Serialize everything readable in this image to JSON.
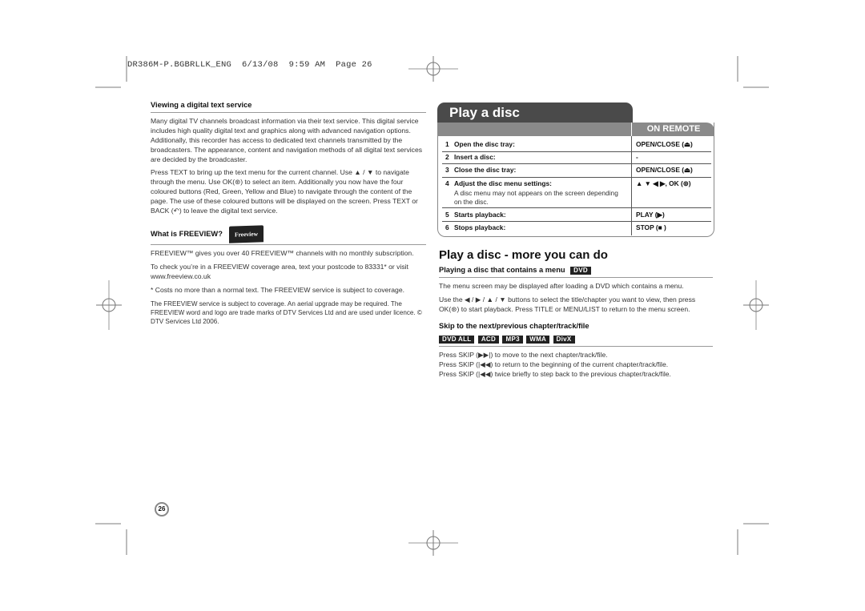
{
  "slug": {
    "file": "DR386M-P.BGBRLLK_ENG",
    "date": "6/13/08",
    "time": "9:59 AM",
    "page_label": "Page 26"
  },
  "left": {
    "section1": {
      "heading": "Viewing a digital text service",
      "p1": "Many digital TV channels broadcast information via their text service. This digital service includes high quality digital text and graphics along with advanced navigation options. Additionally, this recorder has access to dedicated text channels transmitted by the broadcasters. The appearance, content and navigation methods of all digital text services are decided by the broadcaster.",
      "p2": "Press TEXT to bring up the text menu for the current channel. Use ▲ / ▼ to navigate through the menu. Use OK(⊛) to select an item. Additionally you now have the four coloured buttons (Red, Green, Yellow and Blue) to navigate through the content of the page. The use of these coloured buttons will be displayed on the screen. Press TEXT or BACK (↶) to leave the digital text service."
    },
    "section2": {
      "heading": "What is FREEVIEW?",
      "logo_text": "Freeview",
      "p1": "FREEVIEW™ gives you over 40 FREEVIEW™ channels with no monthly subscription.",
      "p2": "To check you’re in a FREEVIEW coverage area, text your postcode to 83331* or visit www.freeview.co.uk",
      "p3": "* Costs no more than a normal text. The FREEVIEW service is subject to coverage.",
      "p4": "The FREEVIEW service is subject to coverage. An aerial upgrade may be required. The FREEVIEW word and logo are trade marks of DTV Services Ltd and are used under licence. © DTV Services Ltd 2006."
    }
  },
  "play_disc": {
    "title": "Play a disc",
    "remote_header": "ON REMOTE",
    "steps": [
      {
        "num": "1",
        "label": "Open the disc tray:",
        "key": "OPEN/CLOSE (⏏)"
      },
      {
        "num": "2",
        "label": "Insert a disc:",
        "key": "-"
      },
      {
        "num": "3",
        "label": "Close the disc tray:",
        "key": "OPEN/CLOSE (⏏)"
      },
      {
        "num": "4",
        "label": "Adjust the disc menu settings:",
        "sub": "A disc menu may not appears on the screen depending on the disc.",
        "key": "▲ ▼ ◀ ▶, OK (⊚)"
      },
      {
        "num": "5",
        "label": "Starts playback:",
        "key": "PLAY (▶)"
      },
      {
        "num": "6",
        "label": "Stops playback:",
        "key": "STOP (■ )"
      }
    ]
  },
  "more": {
    "title": "Play a disc - more you can do",
    "menu_section": {
      "heading": "Playing a disc that contains a menu",
      "badge": "DVD",
      "p1": "The menu screen may be displayed after loading a DVD which contains a menu.",
      "p2": "Use the ◀ / ▶ / ▲ / ▼ buttons to select the title/chapter you want to view, then press OK(⊛) to start playback. Press TITLE or MENU/LIST to return to the menu screen."
    },
    "skip_section": {
      "heading": "Skip to the next/previous chapter/track/file",
      "badges": [
        "DVD ALL",
        "ACD",
        "MP3",
        "WMA",
        "DivX"
      ],
      "lines": [
        "Press SKIP (▶▶|) to move to the next chapter/track/file.",
        "Press SKIP (|◀◀) to return to the beginning of the current chapter/track/file.",
        "Press SKIP (|◀◀) twice briefly to step back to the previous chapter/track/file."
      ]
    }
  },
  "page_number": "26"
}
